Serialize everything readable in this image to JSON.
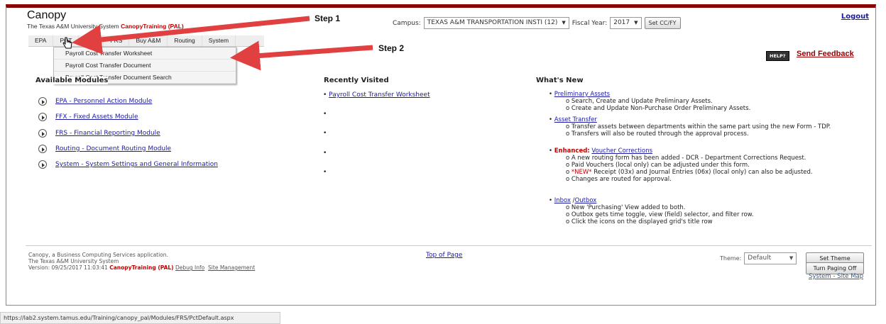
{
  "app": {
    "title": "Canopy",
    "subtitle": "The Texas A&M University System",
    "subtitle_red": "CanopyTraining (PAL)",
    "logout": "Logout"
  },
  "annotations": {
    "step1": "Step 1",
    "step2": "Step 2",
    "arrow_color": "#e04040"
  },
  "campus": {
    "label": "Campus:",
    "value": "TEXAS A&M TRANSPORTATION INSTI (12)",
    "fy_label": "Fiscal Year:",
    "fy_value": "2017",
    "set_button": "Set CC/FY"
  },
  "menu": [
    "EPA",
    "PCT",
    "FFX",
    "FRS",
    "Buy A&M",
    "Routing",
    "System"
  ],
  "dropdown": [
    "Payroll Cost Transfer Worksheet",
    "Payroll Cost Transfer Document",
    "Payroll Cost Transfer Document Search"
  ],
  "help": {
    "label": "HELP?",
    "feedback": "Send Feedback"
  },
  "available_modules": {
    "heading": "Available Modules",
    "items": [
      "EPA - Personnel Action Module",
      "FFX - Fixed Assets Module",
      "FRS - Financial Reporting Module",
      "Routing - Document Routing Module",
      "System - System Settings and General Information"
    ]
  },
  "recently_visited": {
    "heading": "Recently Visited",
    "items": [
      "Payroll Cost Transfer Worksheet",
      "",
      "",
      "",
      ""
    ]
  },
  "whats_new": {
    "heading": "What's New",
    "items": [
      {
        "title": "Preliminary Assets",
        "subs": [
          "Search, Create and Update Preliminary Assets.",
          "Create and Update Non-Purchase Order Preliminary Assets."
        ]
      },
      {
        "title": "Asset Transfer",
        "subs": [
          "Transfer assets between departments within the same part using the new Form - TDP.",
          "Transfers will also be routed through the approval process."
        ]
      },
      {
        "prefix": "Enhanced:",
        "title": "Voucher Corrections",
        "subs": [
          "A new routing form has been added - DCR - Department Corrections Request.",
          "Paid Vouchers (local only) can be adjusted under this form.",
          "Receipt (03x) and Journal Entries (06x) (local only) can also be adjusted.",
          "Changes are routed for approval."
        ],
        "new_tag": "*NEW*"
      },
      {
        "title": "Inbox",
        "title2": "Outbox",
        "subs": [
          "New 'Purchasing' View added to both.",
          "Outbox gets time toggle, view (field) selector, and filter row.",
          "Click the icons on the displayed grid's title row"
        ]
      }
    ]
  },
  "footer": {
    "line1": "Canopy, a Business Computing Services application.",
    "line2": "The Texas A&M University System",
    "line3": "Version: 09/25/2017 11:03:41",
    "env": "CanopyTraining (PAL)",
    "debug": "Debug Info",
    "site_mgmt": "Site Management",
    "top_of_page": "Top of Page",
    "theme_label": "Theme:",
    "theme_value": "Default",
    "set_theme": "Set Theme",
    "paging": "Turn Paging Off",
    "sys_site_map": "System - Site Map"
  },
  "status_url": "https://lab2.system.tamus.edu/Training/canopy_pal/Modules/FRS/PctDefault.aspx"
}
